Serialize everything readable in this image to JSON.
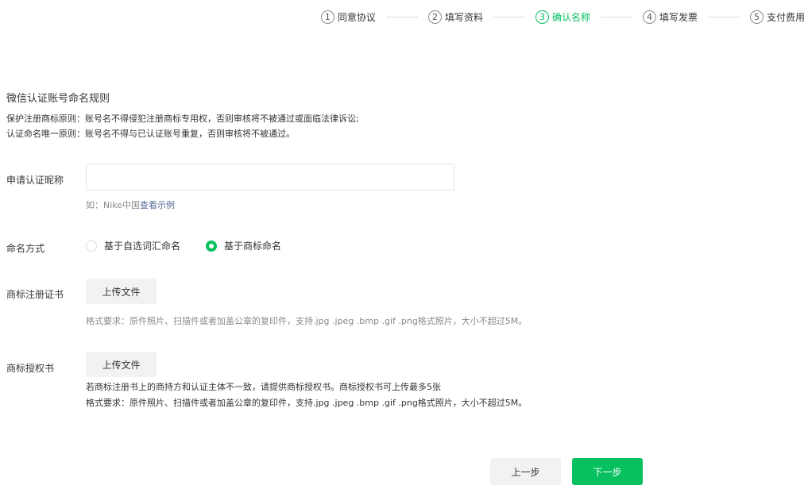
{
  "steps": [
    {
      "num": "1",
      "label": "同意协议"
    },
    {
      "num": "2",
      "label": "填写资料"
    },
    {
      "num": "3",
      "label": "确认名称"
    },
    {
      "num": "4",
      "label": "填写发票"
    },
    {
      "num": "5",
      "label": "支付费用"
    }
  ],
  "rules": {
    "title": "微信认证账号命名规则",
    "line1": "保护注册商标原则：账号名不得侵犯注册商标专用权，否则审核将不被通过或面临法律诉讼;",
    "line2": "认证命名唯一原则：账号名不得与已认证账号重复，否则审核将不被通过。"
  },
  "nickname": {
    "label": "申请认证昵称",
    "value": "",
    "hint_prefix": "如：Nike中国",
    "hint_link": "查看示例"
  },
  "naming": {
    "label": "命名方式",
    "options": [
      "基于自选词汇命名",
      "基于商标命名"
    ],
    "selected": "基于商标命名"
  },
  "trademark_cert": {
    "label": "商标注册证书",
    "button": "上传文件",
    "format": "格式要求：原件照片、扫描件或者加盖公章的复印件，支持.jpg .jpeg .bmp .gif .png格式照片，大小不超过5M。"
  },
  "trademark_auth": {
    "label": "商标授权书",
    "button": "上传文件",
    "note": "若商标注册书上的商持方和认证主体不一致，请提供商标授权书。商标授权书可上传最多5张",
    "format": "格式要求：原件照片、扫描件或者加盖公章的复印件，支持.jpg .jpeg .bmp .gif .png格式照片，大小不超过5M。"
  },
  "actions": {
    "prev": "上一步",
    "next": "下一步"
  },
  "colors": {
    "accent": "#07c160",
    "link": "#576b95"
  }
}
